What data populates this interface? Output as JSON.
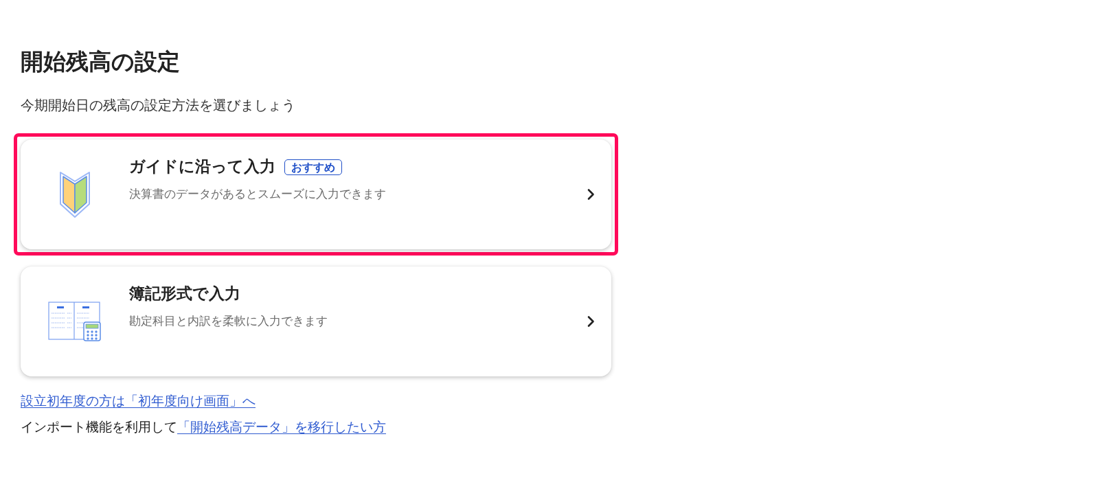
{
  "page": {
    "title": "開始残高の設定",
    "subtitle": "今期開始日の残高の設定方法を選びましょう"
  },
  "options": [
    {
      "kind": "guide",
      "title": "ガイドに沿って入力",
      "badge": "おすすめ",
      "description": "決算書のデータがあるとスムーズに入力できます",
      "highlighted": true
    },
    {
      "kind": "ledger",
      "title": "簿記形式で入力",
      "description": "勘定科目と内訳を柔軟に入力できます",
      "highlighted": false
    }
  ],
  "links": [
    {
      "kind": "link",
      "text": "設立初年度の方は「初年度向け画面」へ"
    },
    {
      "kind": "sentence",
      "text": "インポート機能を利用して",
      "link": "「開始残高データ」を移行したい方"
    }
  ]
}
